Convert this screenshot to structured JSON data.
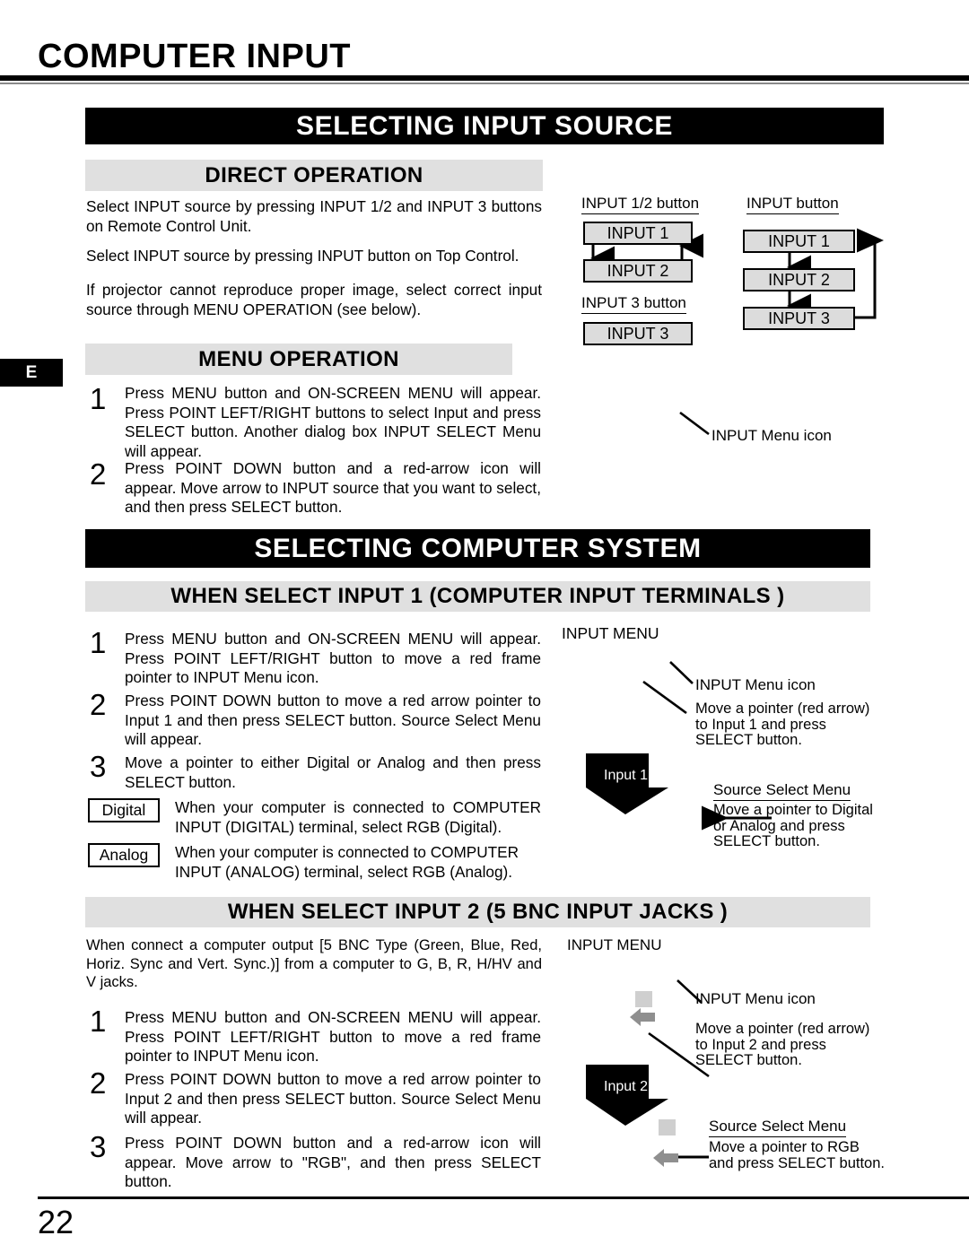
{
  "page": {
    "title": "COMPUTER INPUT",
    "number": "22",
    "side_tab": "E"
  },
  "section_input_source": {
    "banner": "SELECTING INPUT SOURCE",
    "direct_operation": {
      "heading": "DIRECT OPERATION",
      "paragraphs": [
        "Select INPUT source by pressing INPUT 1/2 and INPUT 3 buttons on Remote Control Unit.",
        "Select INPUT source by pressing INPUT button on Top Control.",
        "If projector cannot reproduce proper image, select correct input source through MENU OPERATION (see below)."
      ]
    },
    "diagram": {
      "remote_label_12": "INPUT 1/2 button",
      "remote_label_3": "INPUT 3 button",
      "top_label": "INPUT button",
      "remote_boxes_12": [
        "INPUT 1",
        "INPUT 2"
      ],
      "remote_box_3": "INPUT 3",
      "top_boxes": [
        "INPUT 1",
        "INPUT 2",
        "INPUT 3"
      ]
    },
    "menu_operation": {
      "heading": "MENU OPERATION",
      "steps": [
        {
          "num": "1",
          "text": "Press MENU button and ON-SCREEN MENU will appear.  Press POINT LEFT/RIGHT buttons to select Input and press  SELECT button.  Another dialog box INPUT SELECT Menu will appear."
        },
        {
          "num": "2",
          "text": "Press POINT DOWN button and a red-arrow icon will appear. Move arrow to INPUT source that you want to select, and then press SELECT button."
        }
      ],
      "callout": "INPUT Menu icon"
    }
  },
  "section_computer_system": {
    "banner": "SELECTING COMPUTER SYSTEM",
    "input1": {
      "heading": "WHEN SELECT  INPUT 1 (COMPUTER INPUT TERMINALS )",
      "steps": [
        {
          "num": "1",
          "text": "Press MENU button and ON-SCREEN MENU will appear.  Press POINT LEFT/RIGHT button to move a red frame pointer to INPUT Menu icon."
        },
        {
          "num": "2",
          "text": "Press POINT DOWN button to move a red arrow pointer to Input 1 and then press SELECT button.  Source Select Menu will appear."
        },
        {
          "num": "3",
          "text": "Move a pointer to either Digital or Analog and then press SELECT button."
        }
      ],
      "keys": [
        {
          "label": "Digital",
          "text": "When your computer is connected to COMPUTER INPUT (DIGITAL) terminal, select RGB (Digital)."
        },
        {
          "label": "Analog",
          "text": "When your computer is connected to COMPUTER INPUT (ANALOG) terminal, select RGB (Analog)."
        }
      ],
      "diagram": {
        "menu_title": "INPUT MENU",
        "icon_callout": "INPUT Menu icon",
        "pointer_callout": "Move a pointer (red arrow) to Input 1 and press SELECT button.",
        "badge": "Input 1",
        "source_menu_title": "Source Select Menu ",
        "source_menu_callout": "Move a pointer to Digital or Analog and press SELECT button."
      }
    },
    "input2": {
      "heading": "WHEN SELECT INPUT 2 (5 BNC INPUT JACKS )",
      "intro": "When connect a computer output [5 BNC Type (Green, Blue, Red, Horiz. Sync and Vert. Sync.)] from a computer to G, B, R, H/HV and V jacks.",
      "steps": [
        {
          "num": "1",
          "text": "Press MENU button and ON-SCREEN MENU will appear.  Press POINT LEFT/RIGHT button to move a red frame pointer to INPUT Menu icon."
        },
        {
          "num": "2",
          "text": "Press POINT DOWN button to move a red arrow pointer to Input 2 and then press SELECT button.  Source Select Menu will appear."
        },
        {
          "num": "3",
          "text": "Press POINT DOWN button and a red-arrow icon will appear. Move arrow to \"RGB\", and then press SELECT button."
        }
      ],
      "diagram": {
        "menu_title": "INPUT MENU",
        "icon_callout": "INPUT Menu icon",
        "pointer_callout": "Move a pointer (red arrow) to Input 2 and press SELECT button.",
        "badge": "Input 2",
        "source_menu_title": "Source Select Menu ",
        "source_menu_callout": "Move a pointer to RGB and press SELECT button."
      }
    }
  },
  "colors": {
    "banner_black": "#000000",
    "banner_gray": "#e0e0e0",
    "flowbox_gray": "#dcdcdc",
    "ghost_gray": "#cfcfcf"
  }
}
